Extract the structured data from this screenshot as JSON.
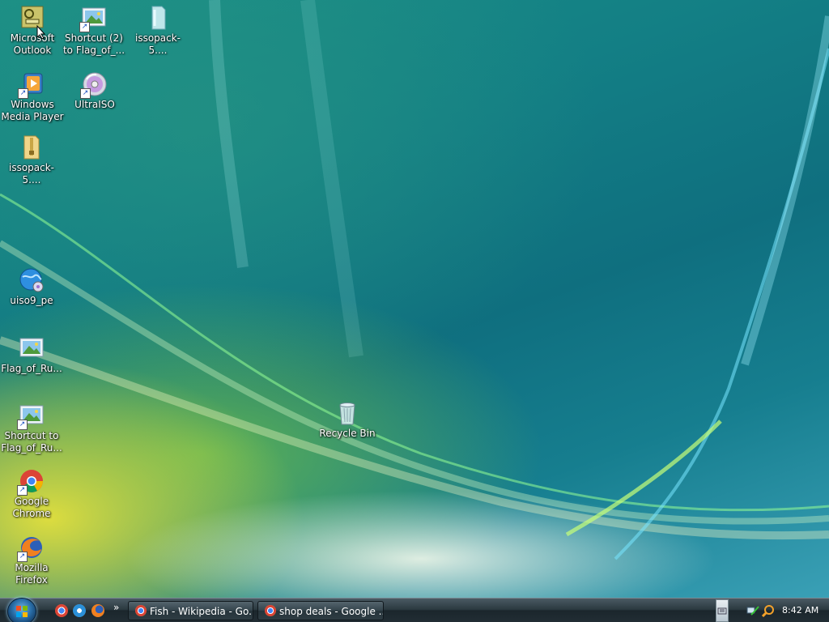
{
  "desktop": {
    "icons": [
      {
        "name": "microsoft-outlook",
        "label": "Microsoft Outlook"
      },
      {
        "name": "shortcut-2-flag",
        "label": "Shortcut (2) to Flag_of_..."
      },
      {
        "name": "issopack-file",
        "label": "issopack-5...."
      },
      {
        "name": "windows-media-player",
        "label": "Windows Media Player"
      },
      {
        "name": "ultraiso",
        "label": "UltraISO"
      },
      {
        "name": "issopack-zip",
        "label": "issopack-5...."
      },
      {
        "name": "uiso9-pe",
        "label": "uiso9_pe"
      },
      {
        "name": "flag-of-ru",
        "label": "Flag_of_Ru..."
      },
      {
        "name": "shortcut-flag-of-ru",
        "label": "Shortcut to Flag_of_Ru..."
      },
      {
        "name": "google-chrome",
        "label": "Google Chrome"
      },
      {
        "name": "mozilla-firefox",
        "label": "Mozilla Firefox"
      },
      {
        "name": "recycle-bin",
        "label": "Recycle Bin"
      }
    ]
  },
  "taskbar": {
    "quick_launch_more": "»",
    "tasks": [
      {
        "label": "Fish - Wikipedia - Go..."
      },
      {
        "label": "shop deals - Google ..."
      }
    ],
    "clock": "8:42 AM"
  },
  "colors": {
    "taskbar": "#222e35",
    "accent": "#2a6ea8"
  }
}
